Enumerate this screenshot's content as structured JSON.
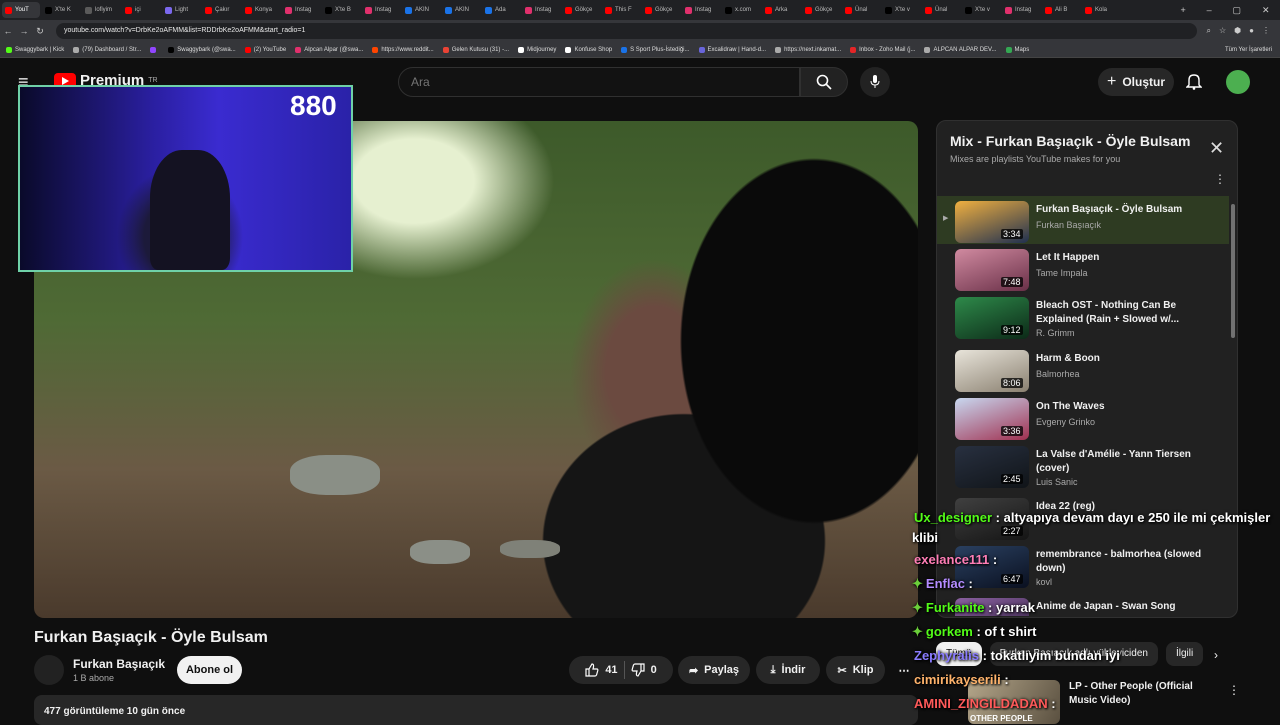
{
  "browser": {
    "tabs": [
      {
        "label": "YouT",
        "color": "#ff0000",
        "active": true
      },
      {
        "label": "X'te K",
        "color": "#000000"
      },
      {
        "label": "lofiyim",
        "color": "#5a5a5a"
      },
      {
        "label": "içi",
        "color": "#ff0000"
      },
      {
        "label": "Light",
        "color": "#7b68ee"
      },
      {
        "label": "Çakır",
        "color": "#ff0000"
      },
      {
        "label": "Konya",
        "color": "#ff0000"
      },
      {
        "label": "Instag",
        "color": "#e1306c"
      },
      {
        "label": "X'te B",
        "color": "#000000"
      },
      {
        "label": "Instag",
        "color": "#e1306c"
      },
      {
        "label": "AKIN",
        "color": "#1a73e8"
      },
      {
        "label": "AKIN",
        "color": "#1a73e8"
      },
      {
        "label": "Ada",
        "color": "#1a73e8"
      },
      {
        "label": "Instag",
        "color": "#e1306c"
      },
      {
        "label": "Gökçe",
        "color": "#ff0000"
      },
      {
        "label": "This F",
        "color": "#ff0000"
      },
      {
        "label": "Gökçe",
        "color": "#ff0000"
      },
      {
        "label": "Instag",
        "color": "#e1306c"
      },
      {
        "label": "x.com",
        "color": "#000000"
      },
      {
        "label": "Arka",
        "color": "#ff0000"
      },
      {
        "label": "Gökçe",
        "color": "#ff0000"
      },
      {
        "label": "Ünal",
        "color": "#ff0000"
      },
      {
        "label": "X'te v",
        "color": "#000000"
      },
      {
        "label": "Ünal",
        "color": "#ff0000"
      },
      {
        "label": "X'te v",
        "color": "#000000"
      },
      {
        "label": "Instag",
        "color": "#e1306c"
      },
      {
        "label": "Ali B",
        "color": "#ff0000"
      },
      {
        "label": "Kola",
        "color": "#ff0000"
      }
    ],
    "url": "youtube.com/watch?v=DrbKe2oAFMM&list=RDDrbKe2oAFMM&start_radio=1",
    "bookmarks": [
      {
        "label": "Swaggybark | Kick",
        "color": "#53fc18"
      },
      {
        "label": "(79) Dashboard / Str...",
        "color": "#aaaaaa"
      },
      {
        "label": "",
        "color": "#9146ff"
      },
      {
        "label": "Swaggybark (@swa...",
        "color": "#000000"
      },
      {
        "label": "(2) YouTube",
        "color": "#ff0000"
      },
      {
        "label": "Alpcan Alpar (@swa...",
        "color": "#e1306c"
      },
      {
        "label": "https://www.reddit...",
        "color": "#ff4500"
      },
      {
        "label": "Gelen Kutusu (31) -...",
        "color": "#ea4335"
      },
      {
        "label": "Midjourney",
        "color": "#ffffff"
      },
      {
        "label": "Konfuse Shop",
        "color": "#ffffff"
      },
      {
        "label": "S Sport Plus-İstediği...",
        "color": "#1a73e8"
      },
      {
        "label": "Excalidraw | Hand-d...",
        "color": "#6965db"
      },
      {
        "label": "https://next.inkamat...",
        "color": "#aaaaaa"
      },
      {
        "label": "Inbox - Zoho Mail (j...",
        "color": "#e42527"
      },
      {
        "label": "ALPCAN ALPAR DEV...",
        "color": "#aaaaaa"
      },
      {
        "label": "Maps",
        "color": "#34a853"
      }
    ],
    "all_bookmarks": "Tüm Yer İşaretleri"
  },
  "header": {
    "logo_text": "Premium",
    "region": "TR",
    "search_placeholder": "Ara",
    "create_label": "Oluştur"
  },
  "webcam": {
    "counter": "880"
  },
  "video": {
    "title": "Furkan Başıaçık - Öyle Bulsam",
    "channel": "Furkan Başıaçık",
    "subs": "1 B abone",
    "subscribe_label": "Abone ol",
    "likes": "41",
    "dislikes": "0",
    "share_label": "Paylaş",
    "download_label": "İndir",
    "clip_label": "Klip",
    "views": "477 görüntüleme  10 gün önce"
  },
  "playlist": {
    "title": "Mix - Furkan Başıaçık - Öyle Bulsam",
    "subtitle": "Mixes are playlists YouTube makes for you",
    "items": [
      {
        "title": "Furkan Başıaçık - Öyle Bulsam",
        "artist": "Furkan Başıaçık",
        "duration": "3:34",
        "active": true,
        "c1": "#f0b040",
        "c2": "#203050"
      },
      {
        "title": "Let It Happen",
        "artist": "Tame Impala",
        "duration": "7:48",
        "c1": "#d08aa0",
        "c2": "#6a3048"
      },
      {
        "title": "Bleach OST - Nothing Can Be Explained (Rain + Slowed w/...",
        "artist": "R. Grimm",
        "duration": "9:12",
        "c1": "#2e8a4a",
        "c2": "#0c2a18"
      },
      {
        "title": "Harm & Boon",
        "artist": "Balmorhea",
        "duration": "8:06",
        "c1": "#e8e4da",
        "c2": "#8a8070"
      },
      {
        "title": "On The Waves",
        "artist": "Evgeny Grinko",
        "duration": "3:36",
        "c1": "#c8d8f0",
        "c2": "#a03050"
      },
      {
        "title": "La Valse d'Amélie - Yann Tiersen (cover)",
        "artist": "Luis Sanic",
        "duration": "2:45",
        "c1": "#283040",
        "c2": "#101418"
      },
      {
        "title": "Idea 22 (reg)",
        "artist": "",
        "duration": "2:27",
        "c1": "#404040",
        "c2": "#151515"
      },
      {
        "title": "remembrance - balmorhea (slowed down)",
        "artist": "kovl",
        "duration": "6:47",
        "c1": "#2a4060",
        "c2": "#0a1020"
      },
      {
        "title": "Anime de Japan - Swan Song",
        "artist": "",
        "duration": "",
        "c1": "#8a60a0",
        "c2": "#302040"
      }
    ]
  },
  "chips": [
    "Tümü",
    "Furkan Başıaçık adlı yükleyiciden",
    "İlgili"
  ],
  "next_video": {
    "title": "LP - Other People (Official Music Video)",
    "thumb_text": "OTHER PEOPLE"
  },
  "chat": [
    {
      "user": "Ux_designer",
      "user_color": "#53fc18",
      "text": ": altyapıya devam dayı e 250 ile mi çekmişler",
      "cont": "klibi",
      "badge": false
    },
    {
      "user": "exelance111",
      "user_color": "#ff7eb6",
      "text": ":",
      "badge": false
    },
    {
      "user": "Enflac",
      "user_color": "#b48cff",
      "text": ":",
      "badge": true
    },
    {
      "user": "Furkanite",
      "user_color": "#53fc18",
      "text": ": yarrak",
      "badge": true
    },
    {
      "user": "gorkem",
      "user_color": "#53fc18",
      "text": ": of t shirt",
      "badge": true
    },
    {
      "user": "Zephyralis",
      "user_color": "#8a7cff",
      "text": ": tokatlıyım bundan iyi",
      "badge": false
    },
    {
      "user": "cimirikayserili",
      "user_color": "#ffb36b",
      "text": ":",
      "badge": false
    },
    {
      "user": "AMINI_ZINGILDADAN",
      "user_color": "#ff5a5a",
      "text": ":",
      "badge": false
    }
  ]
}
